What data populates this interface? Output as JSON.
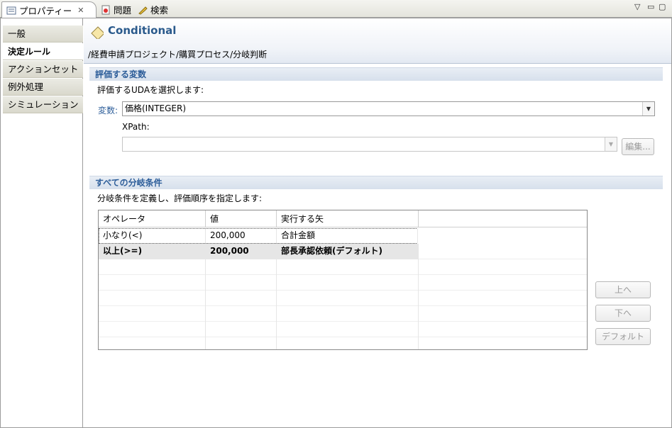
{
  "tabs": [
    {
      "label": "プロパティー",
      "active": true,
      "icon": "properties-icon"
    },
    {
      "label": "問題",
      "active": false,
      "icon": "problems-icon"
    },
    {
      "label": "検索",
      "active": false,
      "icon": "search-icon"
    }
  ],
  "nav": [
    "一般",
    "決定ルール",
    "アクションセット",
    "例外処理",
    "シミュレーション"
  ],
  "header": {
    "title": "Conditional",
    "path": "/経費申請プロジェクト/購買プロセス/分岐判断"
  },
  "variable_section": {
    "title": "評価する変数",
    "description": "評価するUDAを選択します:",
    "variable_label": "変数:",
    "variable_value": "価格(INTEGER)",
    "xpath_label": "XPath:",
    "xpath_value": "",
    "edit_button": "編集..."
  },
  "conditions_section": {
    "title": "すべての分岐条件",
    "description": "分岐条件を定義し、評価順序を指定します:",
    "columns": [
      "オペレータ",
      "値",
      "実行する矢"
    ],
    "rows": [
      {
        "operator": "小なり(<)",
        "value": "200,000",
        "arrow": "合計金額"
      },
      {
        "operator": "以上(>=)",
        "value": "200,000",
        "arrow": "部長承認依頼(デフォルト)"
      }
    ],
    "buttons": {
      "up": "上へ",
      "down": "下へ",
      "default": "デフォルト"
    }
  },
  "colors": {
    "section_title": "#2c5d99",
    "header_title": "#2a5a8c"
  }
}
